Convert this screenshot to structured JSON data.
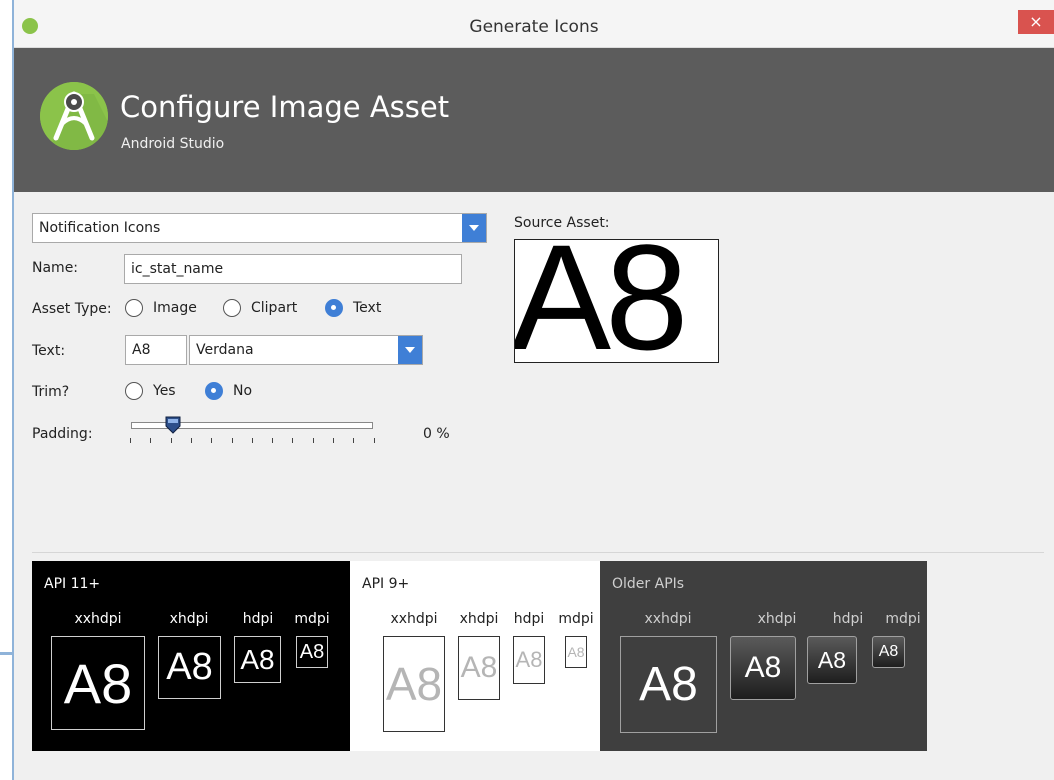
{
  "window": {
    "title": "Generate Icons",
    "close_label": "×"
  },
  "header": {
    "title": "Configure Image Asset",
    "subtitle": "Android Studio"
  },
  "form": {
    "icon_type": "Notification Icons",
    "name_label": "Name:",
    "name_value": "ic_stat_name",
    "asset_type_label": "Asset Type:",
    "asset_type_options": [
      "Image",
      "Clipart",
      "Text"
    ],
    "asset_type_selected": "Text",
    "text_label": "Text:",
    "text_value": "A8",
    "font_value": "Verdana",
    "trim_label": "Trim?",
    "trim_options": [
      "Yes",
      "No"
    ],
    "trim_selected": "No",
    "padding_label": "Padding:",
    "padding_value": 0,
    "padding_display": "0 %"
  },
  "source": {
    "label": "Source Asset:",
    "preview_text": "A8"
  },
  "preview": {
    "icon_text": "A8",
    "panels": [
      {
        "title": "API 11+",
        "densities": [
          "xxhdpi",
          "xhdpi",
          "hdpi",
          "mdpi"
        ]
      },
      {
        "title": "API 9+",
        "densities": [
          "xxhdpi",
          "xhdpi",
          "hdpi",
          "mdpi"
        ]
      },
      {
        "title": "Older APIs",
        "densities": [
          "xxhdpi",
          "xhdpi",
          "hdpi",
          "mdpi"
        ]
      }
    ]
  },
  "colors": {
    "accent": "#3f7fd6",
    "header_bg": "#5c5c5c",
    "logo_green": "#8bc34a",
    "close_red": "#d9534f"
  }
}
